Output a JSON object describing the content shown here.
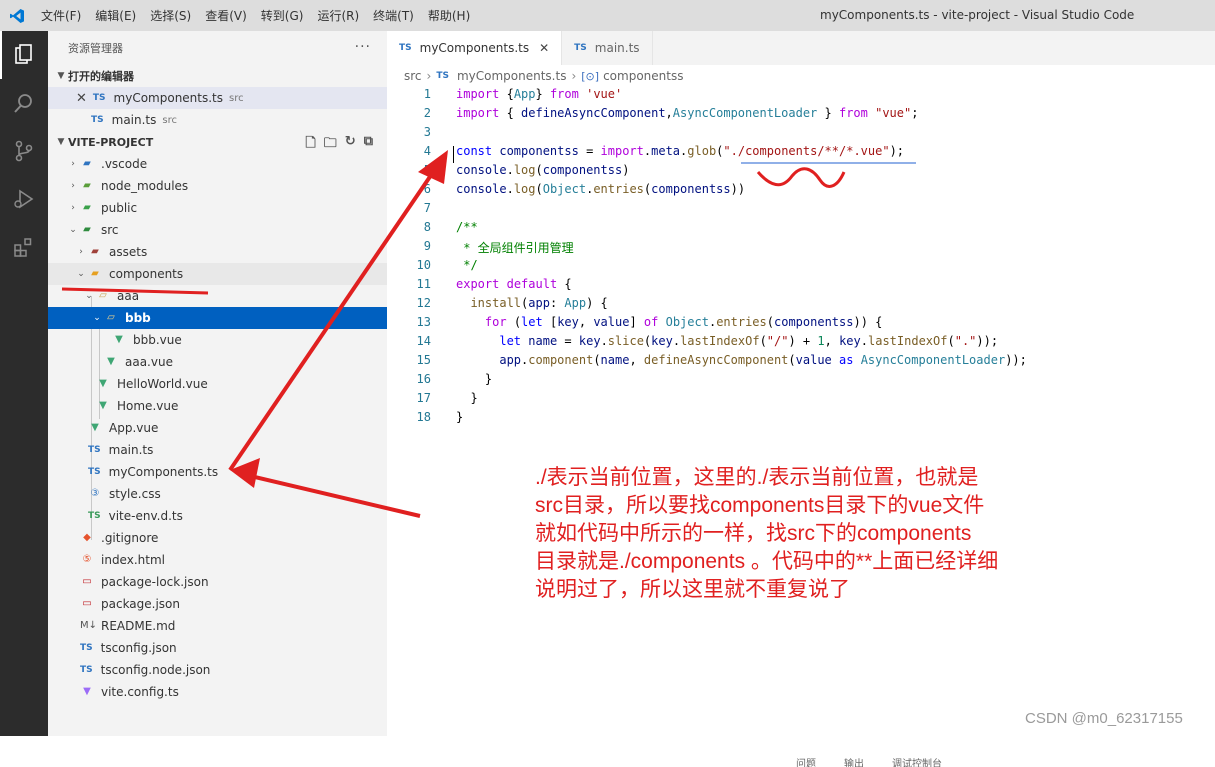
{
  "titlebar": {
    "menu": [
      "文件(F)",
      "编辑(E)",
      "选择(S)",
      "查看(V)",
      "转到(G)",
      "运行(R)",
      "终端(T)",
      "帮助(H)"
    ],
    "window_title": "myComponents.ts - vite-project - Visual Studio Code"
  },
  "sidebar": {
    "header": "资源管理器",
    "open_editors_title": "打开的编辑器",
    "open_editors": [
      {
        "label": "myComponents.ts",
        "desc": "src"
      },
      {
        "label": "main.ts",
        "desc": "src"
      }
    ],
    "project_title": "VITE-PROJECT",
    "tree": [
      ".vscode",
      "node_modules",
      "public",
      "src",
      "assets",
      "components",
      "aaa",
      "bbb",
      "bbb.vue",
      "aaa.vue",
      "HelloWorld.vue",
      "Home.vue",
      "App.vue",
      "main.ts",
      "myComponents.ts",
      "style.css",
      "vite-env.d.ts",
      ".gitignore",
      "index.html",
      "package-lock.json",
      "package.json",
      "README.md",
      "tsconfig.json",
      "tsconfig.node.json",
      "vite.config.ts"
    ]
  },
  "tabs": [
    {
      "label": "myComponents.ts"
    },
    {
      "label": "main.ts"
    }
  ],
  "breadcrumb": [
    "src",
    "myComponents.ts",
    "componentss"
  ],
  "code_lines": [
    "import {App} from 'vue'",
    "import { defineAsyncComponent,AsyncComponentLoader } from \"vue\";",
    "",
    "const componentss = import.meta.glob(\"./components/**/*.vue\");",
    "console.log(componentss)",
    "console.log(Object.entries(componentss))",
    "",
    "/**",
    " * 全局组件引用管理",
    " */",
    "export default {",
    "  install(app: App) {",
    "    for (let [key, value] of Object.entries(componentss)) {",
    "      let name = key.slice(key.lastIndexOf(\"/\") + 1, key.lastIndexOf(\".\"));",
    "      app.component(name, defineAsyncComponent(value as AsyncComponentLoader));",
    "    }",
    "  }",
    "}"
  ],
  "annotation": [
    "./表示当前位置，这里的./表示当前位置，也就是",
    "src目录，所以要找components目录下的vue文件",
    "就如代码中所示的一样，找src下的components",
    "目录就是./components 。代码中的**上面已经详细",
    "说明过了，所以这里就不重复说了"
  ],
  "panel_tabs": [
    "问题",
    "输出",
    "调试控制台"
  ],
  "watermark": "CSDN @m0_62317155",
  "colors": {
    "accent": "#0060c0",
    "annotation": "#e02020"
  }
}
